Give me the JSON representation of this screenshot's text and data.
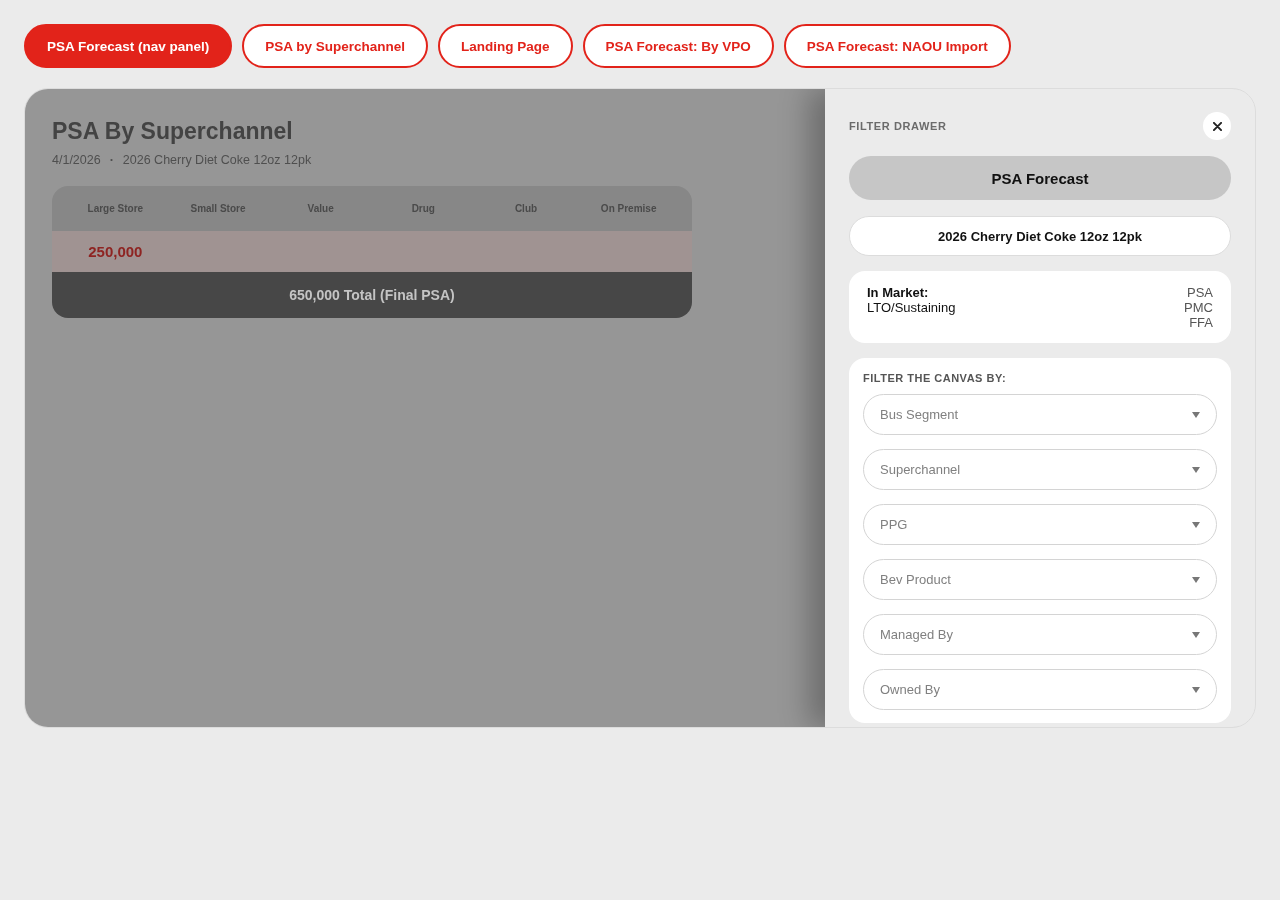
{
  "tabs": [
    {
      "label": "PSA Forecast (nav panel)",
      "selected": true
    },
    {
      "label": "PSA by Superchannel",
      "selected": false
    },
    {
      "label": "Landing Page",
      "selected": false
    },
    {
      "label": "PSA Forecast: By VPO",
      "selected": false
    },
    {
      "label": "PSA Forecast: NAOU Import",
      "selected": false
    }
  ],
  "report": {
    "title": "PSA By Superchannel",
    "date": "4/1/2026",
    "separator": "·",
    "product": "2026 Cherry Diet Coke 12oz 12pk",
    "table": {
      "columns": [
        "Large Store",
        "Small Store",
        "Value",
        "Drug",
        "Club",
        "On Premise"
      ],
      "rows": [
        {
          "cells": [
            "250,000"
          ]
        }
      ],
      "total": "650,000 Total (Final PSA)"
    }
  },
  "drawer": {
    "open": true,
    "title": "FILTER DRAWER",
    "view": "PSA Forecast",
    "product": "2026 Cherry Diet Coke 12oz 12pk",
    "status": {
      "label": "In Market:",
      "value": "LTO/Sustaining",
      "tags": [
        "PSA",
        "PMC",
        "FFA"
      ]
    },
    "filters": {
      "title": "FILTER THE CANVAS BY:",
      "fields": [
        {
          "placeholder": "Bus Segment"
        },
        {
          "placeholder": "Superchannel"
        },
        {
          "placeholder": "PPG"
        },
        {
          "placeholder": "Bev Product"
        },
        {
          "placeholder": "Managed By"
        },
        {
          "placeholder": "Owned By"
        }
      ]
    }
  }
}
